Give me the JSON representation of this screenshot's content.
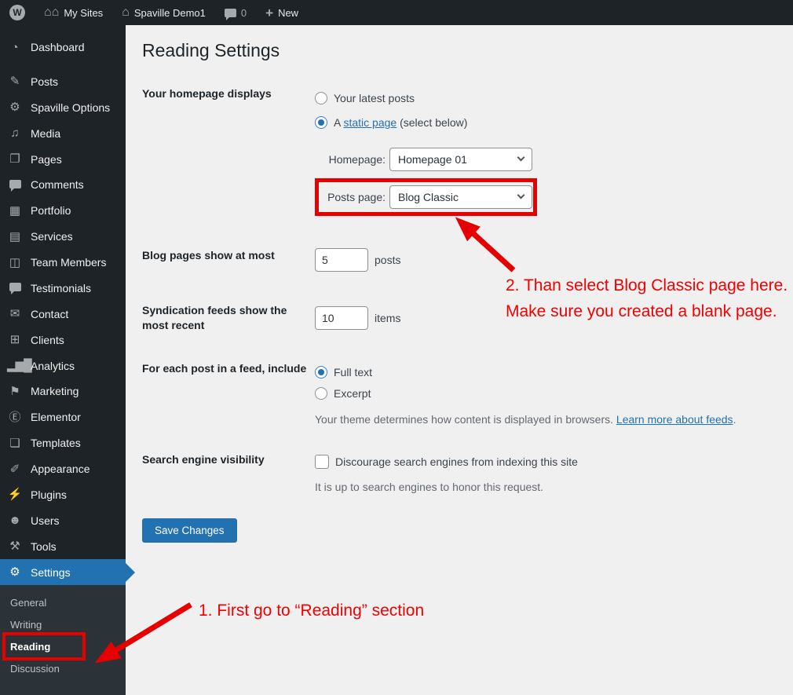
{
  "admin_bar": {
    "my_sites": "My Sites",
    "site_name": "Spaville Demo1",
    "comments_count": "0",
    "new_label": "New"
  },
  "sidebar": {
    "items": [
      {
        "label": "Dashboard"
      },
      {
        "label": "Posts"
      },
      {
        "label": "Spaville Options"
      },
      {
        "label": "Media"
      },
      {
        "label": "Pages"
      },
      {
        "label": "Comments"
      },
      {
        "label": "Portfolio"
      },
      {
        "label": "Services"
      },
      {
        "label": "Team Members"
      },
      {
        "label": "Testimonials"
      },
      {
        "label": "Contact"
      },
      {
        "label": "Clients"
      },
      {
        "label": "Analytics"
      },
      {
        "label": "Marketing"
      },
      {
        "label": "Elementor"
      },
      {
        "label": "Templates"
      },
      {
        "label": "Appearance"
      },
      {
        "label": "Plugins"
      },
      {
        "label": "Users"
      },
      {
        "label": "Tools"
      },
      {
        "label": "Settings"
      }
    ],
    "settings_submenu": [
      {
        "label": "General"
      },
      {
        "label": "Writing"
      },
      {
        "label": "Reading"
      },
      {
        "label": "Discussion"
      }
    ]
  },
  "main": {
    "title": "Reading Settings",
    "homepage": {
      "label": "Your homepage displays",
      "option_latest": "Your latest posts",
      "option_static_prefix": "A ",
      "option_static_link": "static page",
      "option_static_suffix": " (select below)",
      "homepage_label": "Homepage:",
      "homepage_value": "Homepage 01",
      "posts_page_label": "Posts page:",
      "posts_page_value": "Blog Classic"
    },
    "blog_pages": {
      "label": "Blog pages show at most",
      "value": "5",
      "unit": "posts"
    },
    "syndication": {
      "label": "Syndication feeds show the most recent",
      "value": "10",
      "unit": "items"
    },
    "feed": {
      "label": "For each post in a feed, include",
      "option_full": "Full text",
      "option_excerpt": "Excerpt",
      "help_prefix": "Your theme determines how content is displayed in browsers. ",
      "help_link": "Learn more about feeds",
      "help_suffix": "."
    },
    "search": {
      "label": "Search engine visibility",
      "checkbox_label": "Discourage search engines from indexing this site",
      "help": "It is up to search engines to honor this request."
    },
    "save_button": "Save Changes"
  },
  "annotations": {
    "step1_text": "1. First go to “Reading” section",
    "step2_text": "2. Than select Blog Classic page here. Make sure you created a blank page.",
    "accent_red": "#e60000"
  }
}
